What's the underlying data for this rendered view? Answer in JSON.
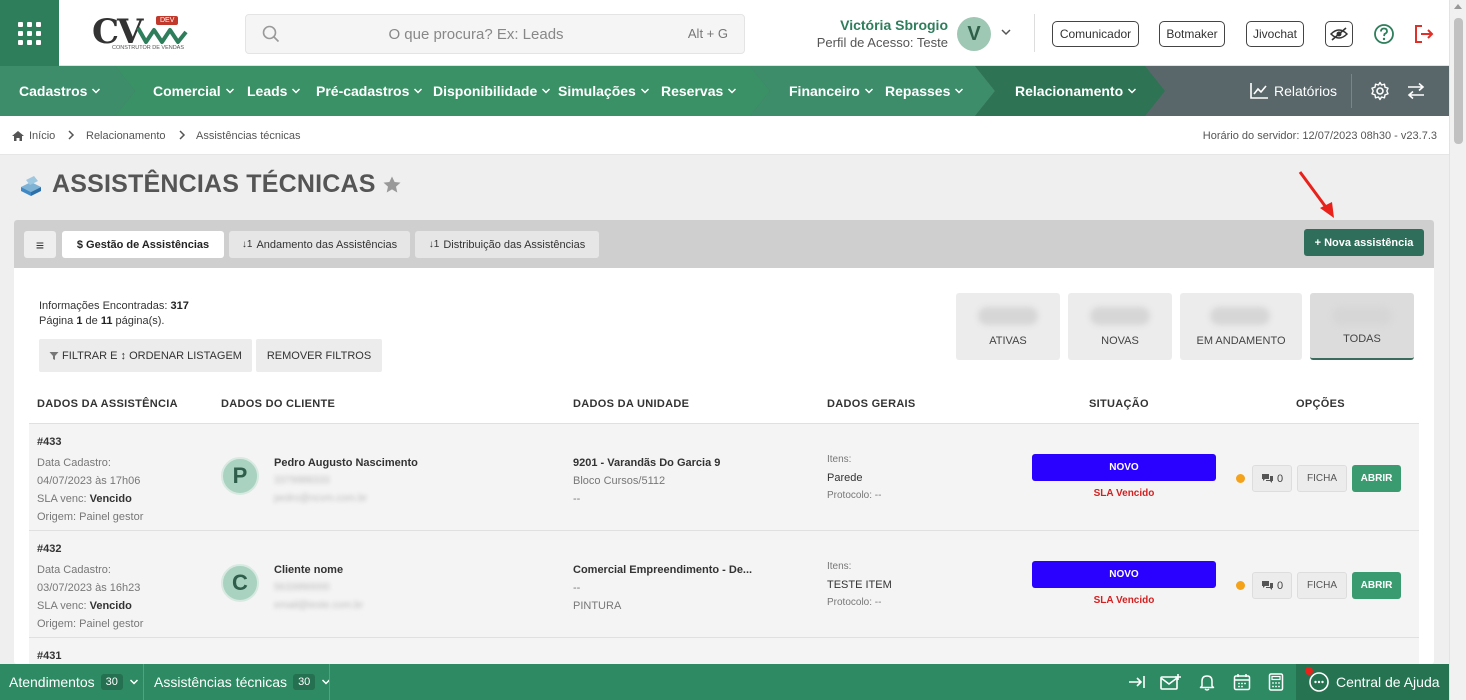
{
  "header": {
    "search_placeholder": "O que procura? Ex: Leads",
    "search_shortcut": "Alt + G",
    "logo_text": "CV",
    "logo_badge": "DEV",
    "logo_subtitle": "CONSTRUTOR DE VENDAS",
    "user_name": "Victória Sbrogio",
    "user_profile": "Perfil de Acesso: Teste",
    "user_initial": "V",
    "buttons": [
      "Comunicador",
      "Botmaker",
      "Jivochat"
    ]
  },
  "nav": {
    "items": [
      "Cadastros",
      "Comercial",
      "Leads",
      "Pré-cadastros",
      "Disponibilidade",
      "Simulações",
      "Reservas",
      "Financeiro",
      "Repasses",
      "Relacionamento"
    ],
    "reports_label": "Relatórios"
  },
  "breadcrumb": {
    "items": [
      "Início",
      "Relacionamento",
      "Assistências técnicas"
    ],
    "server_time": "Horário do servidor: 12/07/2023 08h30 - v23.7.3"
  },
  "page": {
    "title": "ASSISTÊNCIAS TÉCNICAS"
  },
  "tabs": {
    "menu_glyph": "≡",
    "items": [
      "$ Gestão de Assistências",
      "Andamento das Assistências",
      "Distribuição das Assistências"
    ],
    "new_button": "+ Nova assistência"
  },
  "info": {
    "found_label": "Informações Encontradas:",
    "found_count": "317",
    "page_prefix": "Página",
    "page_current": "1",
    "page_of": "de",
    "page_total": "11",
    "page_suffix": "página(s)."
  },
  "filters": {
    "filter_label": "FILTRAR E ↕ ORDENAR LISTAGEM",
    "remove_label": "REMOVER FILTROS"
  },
  "stats": [
    "ATIVAS",
    "NOVAS",
    "EM ANDAMENTO",
    "TODAS"
  ],
  "table": {
    "headers": [
      "DADOS DA ASSISTÊNCIA",
      "DADOS DO CLIENTE",
      "DADOS DA UNIDADE",
      "DADOS GERAIS",
      "SITUAÇÃO",
      "OPÇÕES"
    ],
    "rows": [
      {
        "id": "#433",
        "cad_label": "Data Cadastro:",
        "cad_date": "04/07/2023 às 17h06",
        "sla_label": "SLA venc:",
        "sla_value": "Vencido",
        "origin": "Origem: Painel gestor",
        "initial": "P",
        "client_name": "Pedro Augusto Nascimento",
        "client_phone": "3379988333",
        "client_email": "pedro@ncvm.com.br",
        "unit_title": "9201 - Varandãs Do Garcia 9",
        "unit_l2": "Bloco Cursos/5112",
        "unit_l3": "--",
        "items_label": "Itens:",
        "items_value": "Parede",
        "protocol": "Protocolo: --",
        "status": "NOVO",
        "sla_text": "SLA Vencido",
        "comments": "0",
        "ficha": "FICHA",
        "abrir": "ABRIR"
      },
      {
        "id": "#432",
        "cad_label": "Data Cadastro:",
        "cad_date": "03/07/2023 às 16h23",
        "sla_label": "SLA venc:",
        "sla_value": "Vencido",
        "origin": "Origem: Painel gestor",
        "initial": "C",
        "client_name": "Cliente nome",
        "client_phone": "5633990000",
        "client_email": "email@teste.com.br",
        "unit_title": "Comercial Empreendimento - De...",
        "unit_l2": "--",
        "unit_l3": "PINTURA",
        "items_label": "Itens:",
        "items_value": "TESTE ITEM",
        "protocol": "Protocolo: --",
        "status": "NOVO",
        "sla_text": "SLA Vencido",
        "comments": "0",
        "ficha": "FICHA",
        "abrir": "ABRIR"
      }
    ],
    "next_row_id": "#431"
  },
  "bottom": {
    "atendimentos": "Atendimentos",
    "atendimentos_count": "30",
    "assistencias": "Assistências técnicas",
    "assistencias_count": "30",
    "help": "Central de Ajuda"
  },
  "colors": {
    "brand_green": "#2e7d5b",
    "nav_gray": "#59676a",
    "status_blue": "#2a00ff",
    "sla_red": "#d42020",
    "open_green": "#3b9b70"
  }
}
